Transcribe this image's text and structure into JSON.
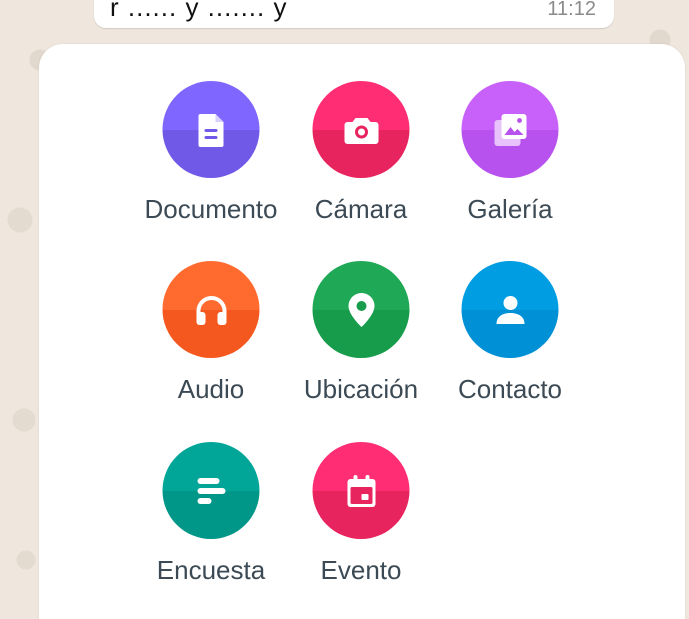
{
  "message": {
    "text": "r ...... y ....... y",
    "time": "11:12"
  },
  "attach_menu": {
    "items": [
      {
        "label": "Documento",
        "icon": "document-icon",
        "color_top": "#7f66ff",
        "color_bottom": "#7159e8"
      },
      {
        "label": "Cámara",
        "icon": "camera-icon",
        "color_top": "#ff2e74",
        "color_bottom": "#e8245f"
      },
      {
        "label": "Galería",
        "icon": "gallery-icon",
        "color_top": "#c861f9",
        "color_bottom": "#b852ef"
      },
      {
        "label": "Audio",
        "icon": "headphones-icon",
        "color_top": "#ff6a2f",
        "color_bottom": "#f5581f"
      },
      {
        "label": "Ubicación",
        "icon": "location-pin-icon",
        "color_top": "#1fa855",
        "color_bottom": "#179c4b"
      },
      {
        "label": "Contacto",
        "icon": "contact-person-icon",
        "color_top": "#009de2",
        "color_bottom": "#0090d6"
      },
      {
        "label": "Encuesta",
        "icon": "poll-icon",
        "color_top": "#02a698",
        "color_bottom": "#009688"
      },
      {
        "label": "Evento",
        "icon": "calendar-event-icon",
        "color_top": "#ff2e74",
        "color_bottom": "#e8245f"
      }
    ]
  }
}
